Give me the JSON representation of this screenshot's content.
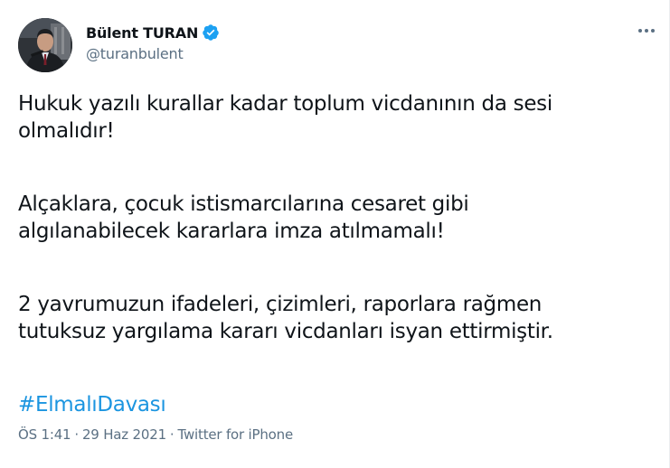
{
  "author": {
    "display_name": "Bülent TURAN",
    "handle": "@turanbulent",
    "verified": true,
    "verified_color": "#1da1f2"
  },
  "tweet": {
    "paragraphs": [
      {
        "line1": "Hukuk yazılı kurallar kadar toplum vicdanının da sesi",
        "line2": "olmalıdır!"
      },
      {
        "line1": "Alçaklara, çocuk istismarcılarına cesaret gibi",
        "line2": "algılanabilecek kararlara imza atılmamalı!"
      },
      {
        "line1": "2 yavrumuzun ifadeleri, çizimleri, raporlara rağmen",
        "line2": "tutuksuz yargılama kararı vicdanları isyan ettirmiştir."
      }
    ],
    "hashtag": "#ElmalıDavası",
    "hashtag_color": "#1b95e0"
  },
  "meta": {
    "time": "ÖS 1:41",
    "separator": "·",
    "date": "29 Haz 2021",
    "source": "Twitter for iPhone"
  },
  "icons": {
    "more": "more-horizontal-icon",
    "verified": "verified-badge-icon"
  }
}
